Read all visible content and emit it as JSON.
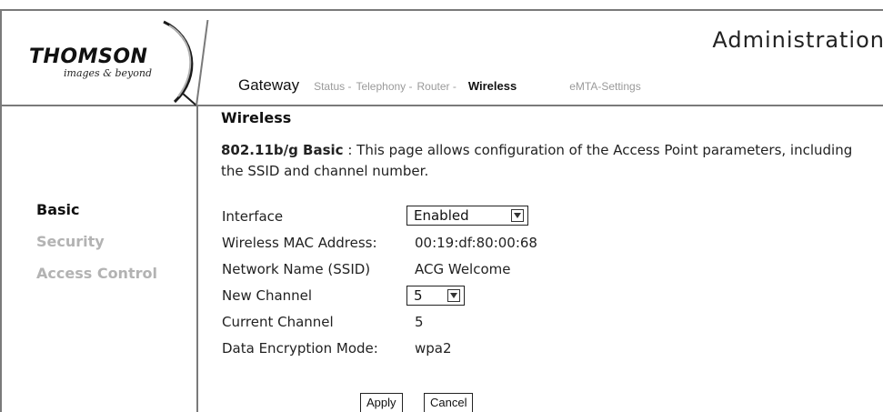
{
  "logo": {
    "brand": "THOMSON",
    "tagline": "images & beyond"
  },
  "header": {
    "title": "Administration",
    "nav_main": "Gateway",
    "nav_items": [
      "Status -",
      "Telephony -",
      "Router -",
      "Wireless",
      "eMTA-Settings"
    ],
    "active_nav": "Wireless"
  },
  "sidebar": {
    "items": [
      {
        "label": "Basic",
        "active": true
      },
      {
        "label": "Security",
        "active": false
      },
      {
        "label": "Access Control",
        "active": false
      }
    ]
  },
  "main": {
    "section_title": "Wireless",
    "desc_strong": "802.11b/g Basic",
    "desc_text": " : This page allows configuration of the Access Point parameters, including the SSID and channel number.",
    "fields": {
      "interface_label": "Interface",
      "interface_value": "Enabled",
      "mac_label": "Wireless MAC Address:",
      "mac_value": "00:19:df:80:00:68",
      "ssid_label": "Network Name (SSID)",
      "ssid_value": "ACG Welcome",
      "new_channel_label": "New Channel",
      "new_channel_value": "5",
      "current_channel_label": "Current Channel",
      "current_channel_value": "5",
      "encryption_label": "Data Encryption Mode:",
      "encryption_value": "wpa2"
    },
    "buttons": {
      "apply": "Apply",
      "cancel": "Cancel"
    }
  },
  "colors": {
    "frame": "#7a7a7a",
    "inactive_text": "#b3b3b3",
    "text": "#111111"
  }
}
